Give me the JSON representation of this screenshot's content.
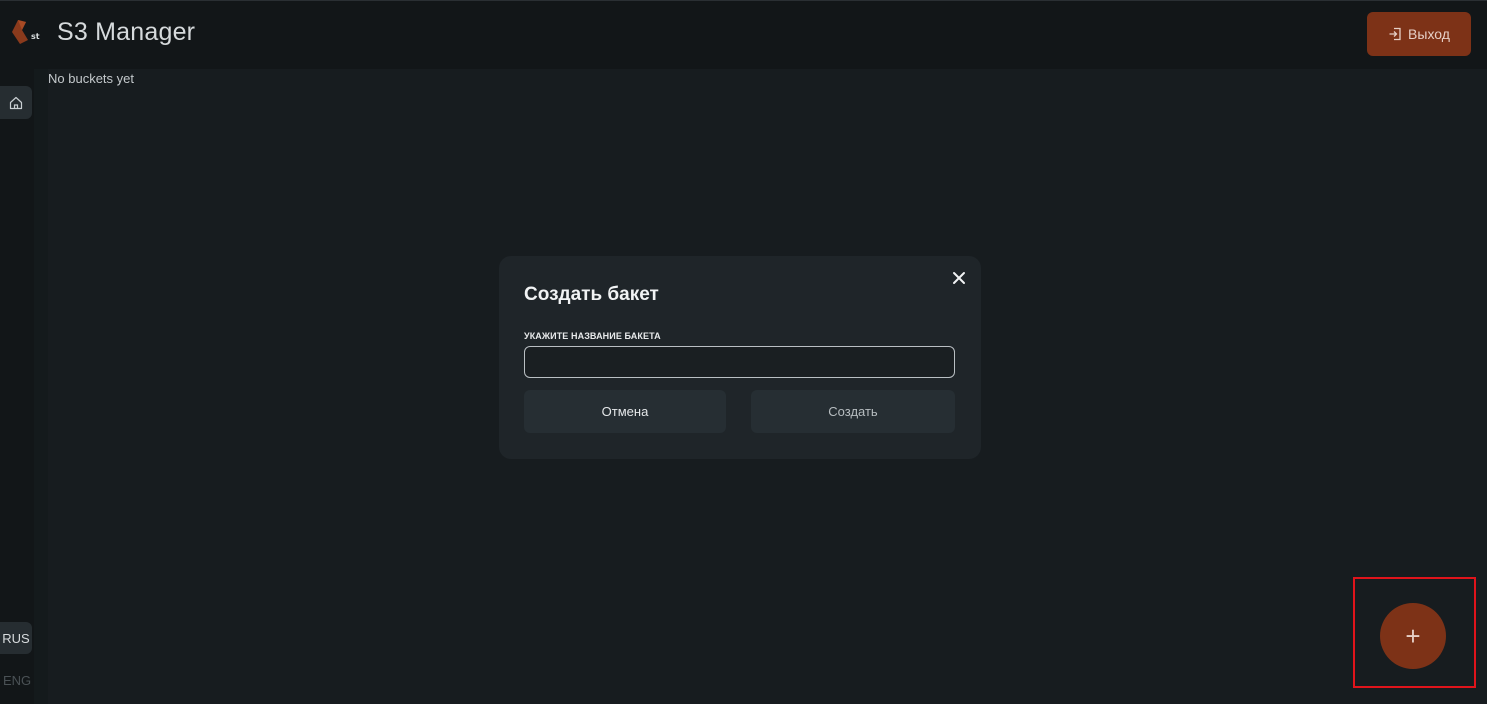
{
  "header": {
    "logo_text": "st",
    "title": "S3 Manager",
    "logout_label": "Выход",
    "logout_icon": "logout-icon"
  },
  "sidebar": {
    "home_icon": "home-icon",
    "languages": [
      {
        "label": "RUS",
        "active": true
      },
      {
        "label": "ENG",
        "active": false
      }
    ]
  },
  "main": {
    "empty_text": "No buckets yet"
  },
  "modal": {
    "title": "Создать бакет",
    "close_icon": "close-icon",
    "field_label": "УКАЖИТЕ НАЗВАНИЕ БАКЕТА",
    "field_value": "",
    "cancel_label": "Отмена",
    "create_label": "Создать"
  },
  "fab": {
    "label": "+"
  },
  "colors": {
    "accent": "#7d3217",
    "highlight": "#e0141b",
    "background": "#171c1f",
    "header": "#121618",
    "modal": "#1f2529"
  }
}
